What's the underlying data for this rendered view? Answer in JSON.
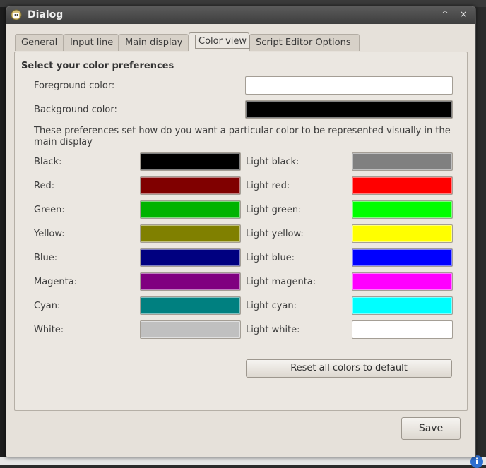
{
  "window": {
    "title": "Dialog",
    "maximize_glyph": "^",
    "close_glyph": "×"
  },
  "tabs": [
    {
      "label": "General",
      "active": false
    },
    {
      "label": "Input line",
      "active": false
    },
    {
      "label": "Main display",
      "active": false
    },
    {
      "label": "Color view",
      "active": true
    },
    {
      "label": "Script Editor Options",
      "active": false
    }
  ],
  "section_title": "Select your color preferences",
  "foreground": {
    "label": "Foreground color:",
    "color": "#ffffff"
  },
  "background": {
    "label": "Background color:",
    "color": "#000000"
  },
  "description": "These preferences set how do you want a particular color to be represented visually in the main display",
  "colors": [
    {
      "label": "Black:",
      "color": "#000000",
      "light_label": "Light black:",
      "light_color": "#808080"
    },
    {
      "label": "Red:",
      "color": "#800000",
      "light_label": "Light red:",
      "light_color": "#ff0000"
    },
    {
      "label": "Green:",
      "color": "#00b300",
      "light_label": "Light green:",
      "light_color": "#00ff00"
    },
    {
      "label": "Yellow:",
      "color": "#808000",
      "light_label": "Light yellow:",
      "light_color": "#ffff00"
    },
    {
      "label": "Blue:",
      "color": "#000080",
      "light_label": "Light blue:",
      "light_color": "#0000ff"
    },
    {
      "label": "Magenta:",
      "color": "#800080",
      "light_label": "Light magenta:",
      "light_color": "#ff00ff"
    },
    {
      "label": "Cyan:",
      "color": "#008080",
      "light_label": "Light cyan:",
      "light_color": "#00ffff"
    },
    {
      "label": "White:",
      "color": "#c0c0c0",
      "light_label": "Light white:",
      "light_color": "#ffffff"
    }
  ],
  "reset_label": "Reset all colors to default",
  "save_label": "Save",
  "desktop": {
    "info_glyph": "i"
  }
}
